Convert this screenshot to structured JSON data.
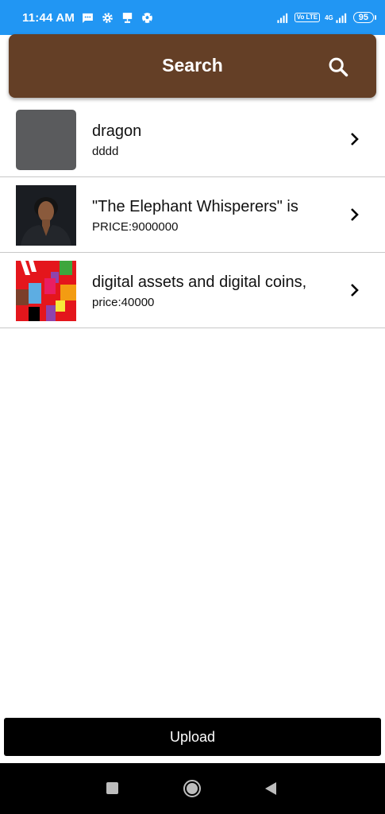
{
  "status_bar": {
    "time": "11:44 AM",
    "network_label": "Vo LTE",
    "network_type": "4G",
    "battery": "95"
  },
  "app_bar": {
    "title": "Search",
    "search_icon": "search-icon"
  },
  "items": [
    {
      "title": "dragon",
      "subtitle": "dddd",
      "thumbnail": "grey-placeholder"
    },
    {
      "title": "\"The Elephant Whisperers\" is",
      "subtitle": "PRICE:9000000",
      "thumbnail": "portrait-photo"
    },
    {
      "title": "digital assets and digital coins,",
      "subtitle": "price:40000",
      "thumbnail": "colorful-abstract"
    }
  ],
  "upload_button": {
    "label": "Upload"
  },
  "colors": {
    "status_bar": "#2196f3",
    "app_bar": "#643f26",
    "upload_button": "#000000"
  }
}
